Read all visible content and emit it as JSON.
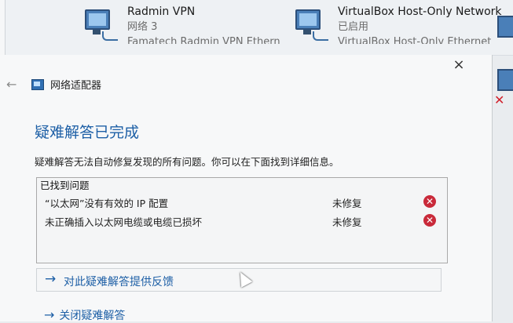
{
  "adapters": [
    {
      "name": "Radmin VPN",
      "status": "网络 3",
      "device": "Famatech Radmin VPN Ethern"
    },
    {
      "name": "VirtualBox Host-Only Network",
      "status": "已启用",
      "device": "VirtualBox Host-Only Ethernet"
    }
  ],
  "dialog": {
    "close_icon": "×",
    "back_icon": "←",
    "nav_title": "网络适配器",
    "heading": "疑难解答已完成",
    "description": "疑难解答无法自动修复发现的所有问题。你可以在下面找到详细信息。",
    "problems_header": "已找到问题",
    "problems": [
      {
        "text": "“以太网”没有有效的 IP 配置",
        "status": "未修复",
        "icon": "error-icon"
      },
      {
        "text": "未正确插入以太网电缆或电缆已损坏",
        "status": "未修复",
        "icon": "error-icon"
      }
    ],
    "feedback_link": "对此疑难解答提供反馈",
    "close_link": "关闭疑难解答",
    "arrow_glyph": "→"
  },
  "colors": {
    "accent": "#1d5fa6",
    "error": "#c92a3a"
  }
}
